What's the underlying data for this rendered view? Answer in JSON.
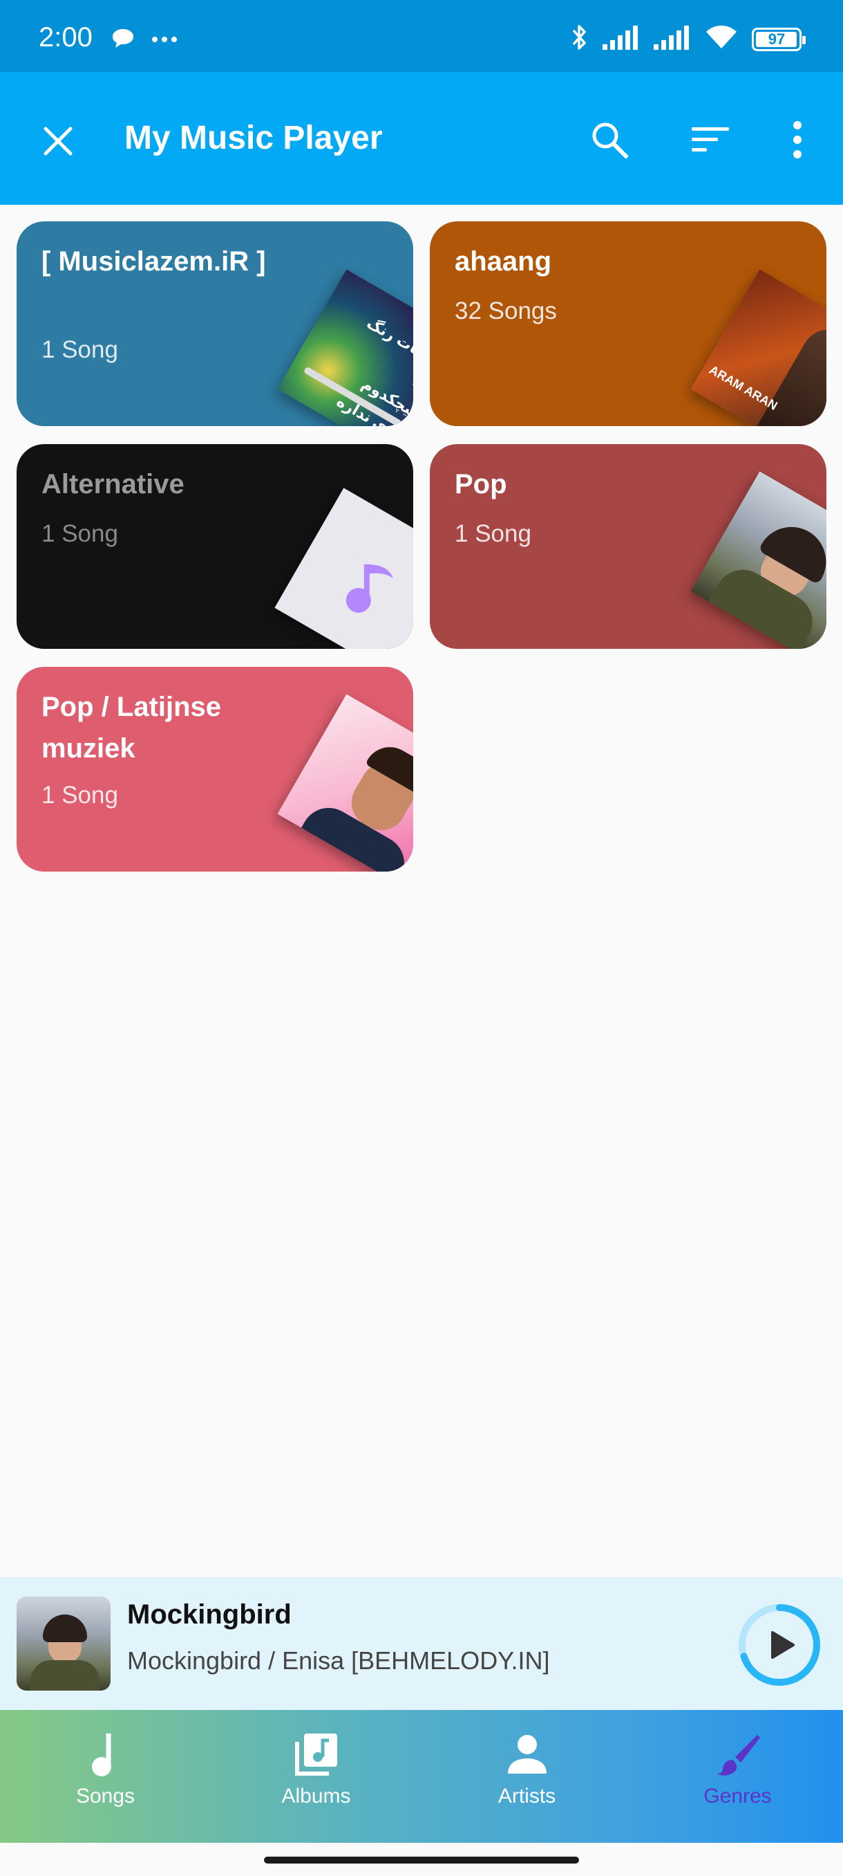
{
  "status_bar": {
    "time": "2:00",
    "battery": "97",
    "battery_level": 0.97,
    "icons": [
      "chat-bubble-icon",
      "more-dots-icon",
      "bluetooth-icon",
      "signal-icon",
      "signal-icon",
      "wifi-icon",
      "battery-icon"
    ]
  },
  "toolbar": {
    "title": "My Music Player",
    "actions": [
      "close-icon",
      "search-icon",
      "sort-icon",
      "more-vert-icon"
    ]
  },
  "genres": [
    {
      "name": "[ Musiclazem.iR ]",
      "count": "1 Song",
      "color": "#2E7BA3"
    },
    {
      "name": "ahaang",
      "count": "32 Songs",
      "color": "#B05608"
    },
    {
      "name": "Alternative",
      "count": "1 Song",
      "color": "#121212"
    },
    {
      "name": "Pop",
      "count": "1 Song",
      "color": "#A64645"
    },
    {
      "name": "Pop / Latijnse muziek",
      "count": "1 Song",
      "color": "#DE5E6F"
    }
  ],
  "art_text": {
    "persian_line1": "چشمات رنگ اره",
    "persian_line2": "هیچکدوم کاری نداره",
    "aram": "ARAM ARAN"
  },
  "mini_player": {
    "title": "Mockingbird",
    "subtitle": "Mockingbird / Enisa [BEHMELODY.IN]",
    "progress": 0.7
  },
  "bottom_nav": {
    "items": [
      {
        "label": "Songs",
        "icon": "music-note-icon"
      },
      {
        "label": "Albums",
        "icon": "album-library-icon"
      },
      {
        "label": "Artists",
        "icon": "person-icon"
      },
      {
        "label": "Genres",
        "icon": "brush-icon"
      }
    ],
    "active": "Genres",
    "active_color": "#5A35C8"
  },
  "colors": {
    "status_bar": "#0290D6",
    "toolbar": "#03A9F4",
    "background": "#FAFAFA",
    "mini_player": "#E1F3FB",
    "accent_ring": "#29B6F6"
  }
}
